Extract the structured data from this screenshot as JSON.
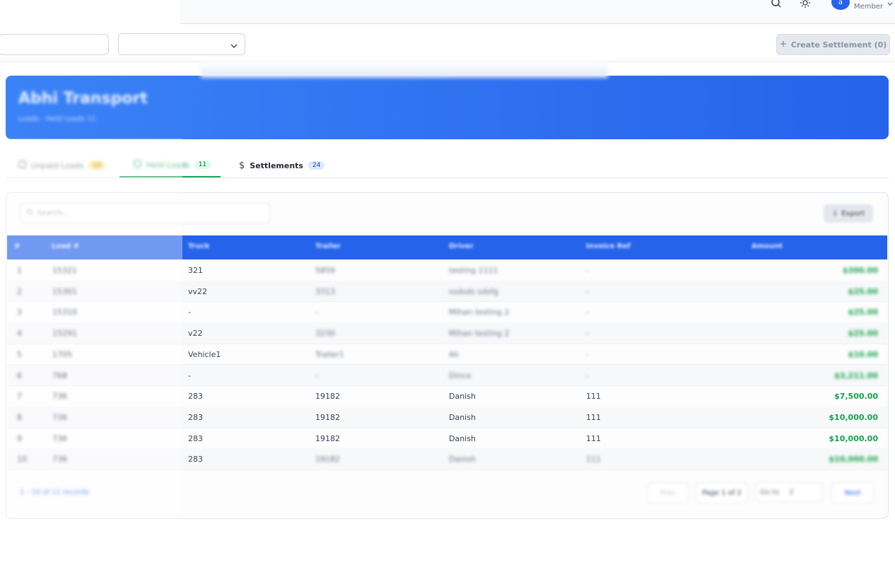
{
  "header": {
    "user_initial": "a",
    "user_role": "Member"
  },
  "toolbar": {
    "create_settlement_label": "Create Settlement (0)"
  },
  "banner": {
    "title": "Abhi Transport",
    "subtitle": "Loads · Held Loads 11"
  },
  "tabs": [
    {
      "label": "Unpaid Loads",
      "count": "12"
    },
    {
      "label": "Held Loads",
      "count": "11"
    },
    {
      "label": "Settlements",
      "count": "24"
    }
  ],
  "table": {
    "search_placeholder": "Search...",
    "export_label": "Export",
    "columns": [
      "#",
      "Load #",
      "Truck",
      "Trailer",
      "Driver",
      "Invoice Ref",
      "Amount"
    ],
    "rows": [
      {
        "n": "1",
        "load": "15321",
        "truck": "321",
        "trailer": "5859",
        "driver": "testing 1111",
        "invoice": "-",
        "amount": "$300.00"
      },
      {
        "n": "2",
        "load": "15301",
        "truck": "vv22",
        "trailer": "3313",
        "driver": "ssdsds sdsfg",
        "invoice": "-",
        "amount": "$25.00"
      },
      {
        "n": "3",
        "load": "15310",
        "truck": "-",
        "trailer": "-",
        "driver": "Mihan testing 2",
        "invoice": "-",
        "amount": "$25.00"
      },
      {
        "n": "4",
        "load": "15291",
        "truck": "v22",
        "trailer": "3230",
        "driver": "Mihan testing 2",
        "invoice": "-",
        "amount": "$25.00"
      },
      {
        "n": "5",
        "load": "1705",
        "truck": "Vehicle1",
        "trailer": "Trailer1",
        "driver": "Ali",
        "invoice": "-",
        "amount": "$10.00"
      },
      {
        "n": "6",
        "load": "768",
        "truck": "-",
        "trailer": "-",
        "driver": "Dince",
        "invoice": "-",
        "amount": "$3,211.00"
      },
      {
        "n": "7",
        "load": "736",
        "truck": "283",
        "trailer": "19182",
        "driver": "Danish",
        "invoice": "111",
        "amount": "$7,500.00"
      },
      {
        "n": "8",
        "load": "736",
        "truck": "283",
        "trailer": "19182",
        "driver": "Danish",
        "invoice": "111",
        "amount": "$10,000.00"
      },
      {
        "n": "9",
        "load": "736",
        "truck": "283",
        "trailer": "19182",
        "driver": "Danish",
        "invoice": "111",
        "amount": "$10,000.00"
      },
      {
        "n": "10",
        "load": "736",
        "truck": "283",
        "trailer": "19182",
        "driver": "Danish",
        "invoice": "111",
        "amount": "$10,000.00"
      }
    ]
  },
  "pagination": {
    "summary": "1 - 10 of 11 records",
    "prev_label": "Prev",
    "page_label": "Page 1 of 2",
    "go_label": "Go to",
    "go_value": "2",
    "next_label": "Next"
  },
  "colors": {
    "accent": "#2563eb",
    "amount_green": "#16a34a",
    "held_green": "#22a35a"
  }
}
